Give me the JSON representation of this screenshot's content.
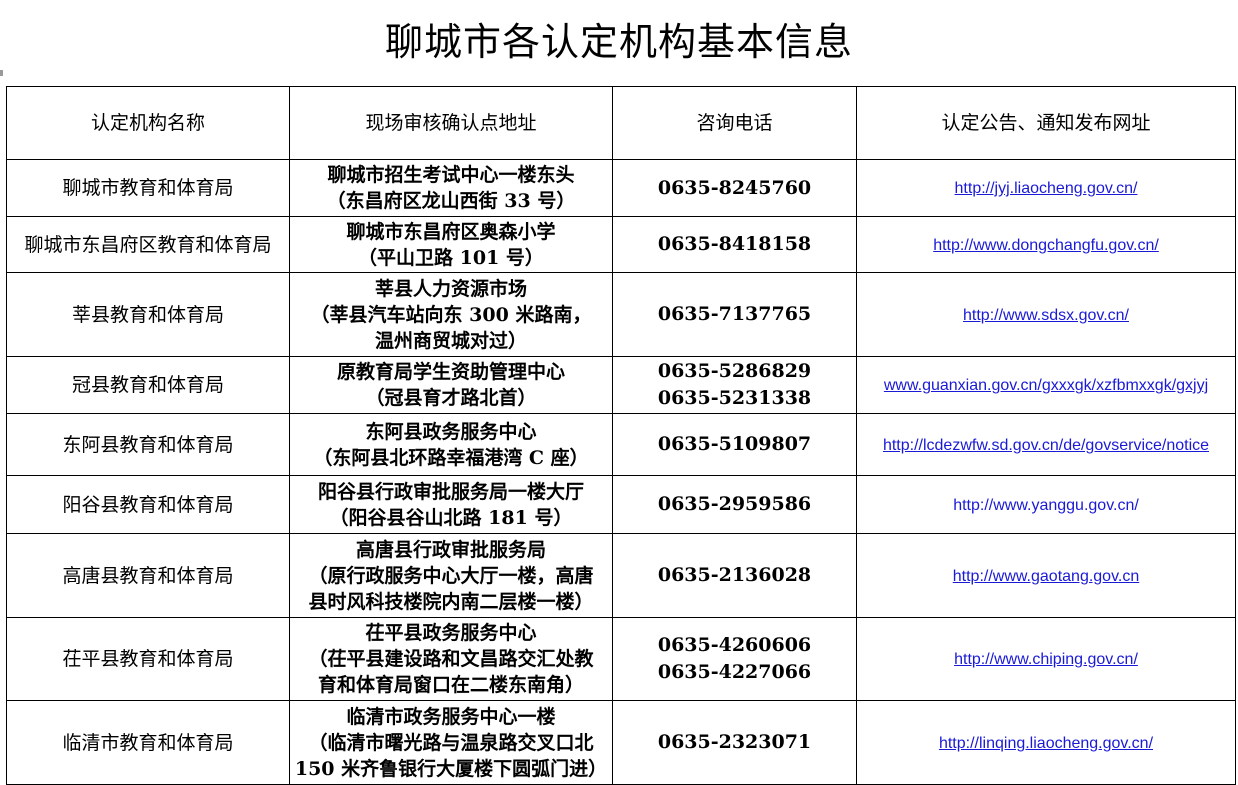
{
  "title": "聊城市各认定机构基本信息",
  "columns": [
    "认定机构名称",
    "现场审核确认点地址",
    "咨询电话",
    "认定公告、通知发布网址"
  ],
  "rows": [
    {
      "org": "聊城市教育和体育局",
      "address": [
        "聊城市招生考试中心一楼东头",
        "（东昌府区龙山西街 33 号）"
      ],
      "phones": [
        "0635-8245760"
      ],
      "url": "http://jyj.liaocheng.gov.cn/",
      "url_underlined": true
    },
    {
      "org": "聊城市东昌府区教育和体育局",
      "address": [
        "聊城市东昌府区奥森小学",
        "（平山卫路 101 号）"
      ],
      "phones": [
        "0635-8418158"
      ],
      "url": "http://www.dongchangfu.gov.cn/",
      "url_underlined": true
    },
    {
      "org": "莘县教育和体育局",
      "address": [
        "莘县人力资源市场",
        "（莘县汽车站向东 300 米路南，",
        "温州商贸城对过）"
      ],
      "phones": [
        "0635-7137765"
      ],
      "url": "http://www.sdsx.gov.cn/",
      "url_underlined": true
    },
    {
      "org": "冠县教育和体育局",
      "address": [
        "原教育局学生资助管理中心",
        "（冠县育才路北首）"
      ],
      "phones": [
        "0635-5286829",
        "0635-5231338"
      ],
      "url": "www.guanxian.gov.cn/gxxxgk/xzfbmxxgk/gxjyj",
      "url_underlined": true
    },
    {
      "org": "东阿县教育和体育局",
      "address": [
        "东阿县政务服务中心",
        "（东阿县北环路幸福港湾 C 座）"
      ],
      "phones": [
        "0635-5109807"
      ],
      "url": "http://lcdezwfw.sd.gov.cn/de/govservice/notice",
      "url_underlined": true
    },
    {
      "org": "阳谷县教育和体育局",
      "address": [
        "阳谷县行政审批服务局一楼大厅",
        "（阳谷县谷山北路 181 号）"
      ],
      "phones": [
        "0635-2959586"
      ],
      "url": "http://www.yanggu.gov.cn/",
      "url_underlined": false
    },
    {
      "org": "高唐县教育和体育局",
      "address": [
        "高唐县行政审批服务局",
        "（原行政服务中心大厅一楼，高唐",
        "县时风科技楼院内南二层楼一楼）"
      ],
      "phones": [
        "0635-2136028"
      ],
      "url": "http://www.gaotang.gov.cn",
      "url_underlined": true
    },
    {
      "org": "茌平县教育和体育局",
      "address": [
        "茌平县政务服务中心",
        "（茌平县建设路和文昌路交汇处教",
        "育和体育局窗口在二楼东南角）"
      ],
      "phones": [
        "0635-4260606",
        "0635-4227066"
      ],
      "url": "http://www.chiping.gov.cn/",
      "url_underlined": true
    },
    {
      "org": "临清市教育和体育局",
      "address": [
        "临清市政务服务中心一楼",
        "（临清市曙光路与温泉路交叉口北",
        "150 米齐鲁银行大厦楼下圆弧门进）"
      ],
      "phones": [
        "0635-2323071"
      ],
      "url": "http://linqing.liaocheng.gov.cn/",
      "url_underlined": true
    }
  ],
  "colors": {
    "link": "#1a1ad6",
    "border": "#000000",
    "background": "#ffffff"
  }
}
